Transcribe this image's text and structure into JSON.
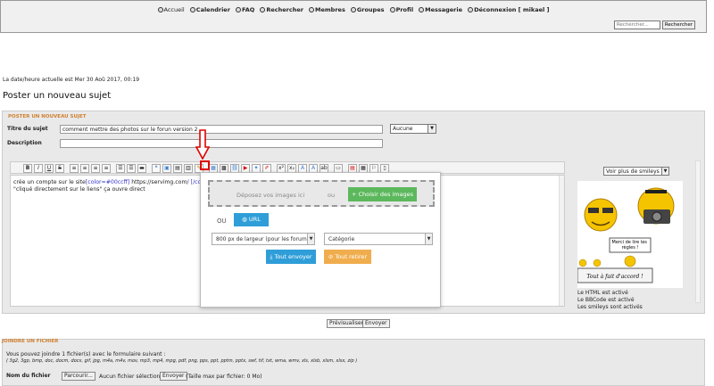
{
  "nav": {
    "items": [
      {
        "icon": "home-icon",
        "label": "Accueil"
      },
      {
        "icon": "calendar-icon",
        "label": "Calendrier"
      },
      {
        "icon": "faq-icon",
        "label": "FAQ"
      },
      {
        "icon": "search-icon",
        "label": "Rechercher"
      },
      {
        "icon": "members-icon",
        "label": "Membres"
      },
      {
        "icon": "groups-icon",
        "label": "Groupes"
      },
      {
        "icon": "profile-icon",
        "label": "Profil"
      },
      {
        "icon": "mail-icon",
        "label": "Messagerie"
      },
      {
        "icon": "logout-icon",
        "label": "Déconnexion [ mikael ]"
      }
    ],
    "search_placeholder": "Rechercher...",
    "search_button": "Rechercher"
  },
  "datetime": "La date/heure actuelle est Mer 30 Aoû 2017, 00:19",
  "page_title": "Poster un nouveau sujet",
  "form": {
    "section_title": "POSTER UN NOUVEAU SUJET",
    "subject_label": "Titre du sujet",
    "subject_value": "comment mettre des photos sur le forun version 2",
    "prefix_select": "Aucune",
    "description_label": "Description",
    "description_value": "",
    "editor_lines": [
      "crée un compte sur le site",
      "[color=#00ccff]",
      " https://servimg.com/ ",
      "[/color]",
      "\"cliqué directement sur le liens\" ça ouvre direct"
    ],
    "smiley_select": "Voir plus de smileys",
    "smiley_texts": {
      "regles": "Merci de lire les règles !",
      "accord": "Tout à fait d'accord !"
    },
    "status": [
      "Le HTML est activé",
      "Le BBCode est activé",
      "Les smileys sont activés"
    ],
    "preview_button": "Prévisualiser",
    "send_button": "Envoyer"
  },
  "upload_popup": {
    "drop_text": "Déposez vos images ici",
    "ou": "ou",
    "choose_button": "+ Choisir des images",
    "ou2": "OU",
    "url_button": "URL",
    "size_select": "800 px de largeur (pour les forums)",
    "category_select": "Catégorie",
    "send_all": "Tout envoyer",
    "cancel_all": "Tout retirer"
  },
  "attach": {
    "section_title": "JOINDRE UN FICHIER",
    "intro": "Vous pouvez joindre 1 fichier(s) avec le formulaire suivant :",
    "formats": "( 3g2, 3gp, bmp, doc, docm, docx, gif, jpg, m4a, m4v, mov, mp3, mp4, mpg, pdf, png, pps, ppt, pptm, pptx, swf, tif, txt, wma, wmv, xls, xlsb, xlsm, xlsx, zip )",
    "file_label": "Nom du fichier",
    "browse": "Parcourir...",
    "none_selected": "Aucun fichier sélectionné.",
    "send": "Envoyer",
    "max_size": "(Taille max par fichier: 0 Mo)"
  },
  "colors": {
    "highlight": "#e00000",
    "green": "#5cb85c",
    "blue": "#2f9ed8",
    "orange": "#f0ad4e"
  }
}
